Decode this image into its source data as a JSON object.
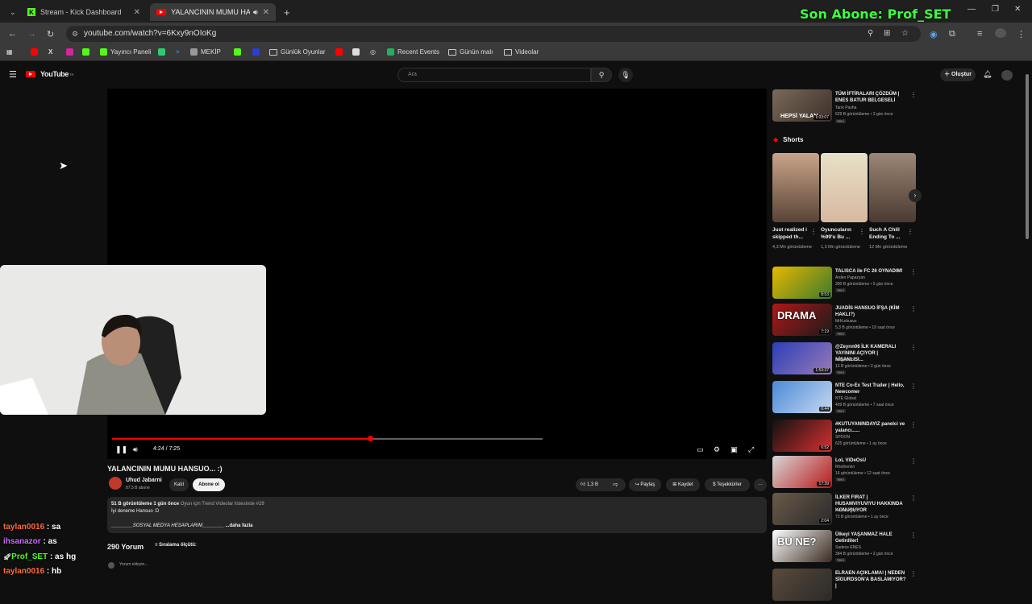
{
  "overlay": {
    "text": "Son Abone: Prof_SET"
  },
  "browser": {
    "tabs": [
      {
        "label": "Stream - Kick Dashboard"
      },
      {
        "label": "YALANCININ MUMU HANSU"
      }
    ],
    "url": "youtube.com/watch?v=6Kxy9nOIoKg",
    "bookmarks": [
      "Yayıncı Paneli",
      "MEKİP",
      "Günlük Oyunlar",
      "Recent Events",
      "Günün malı",
      "Videolar"
    ]
  },
  "youtube": {
    "logo": "YouTube",
    "logo_region": "TR",
    "search_placeholder": "Ara",
    "create_label": "Oluştur",
    "player": {
      "time": "4:24 / 7:25",
      "progress": 0.6
    },
    "video": {
      "title": "YALANCININ MUMU HANSUO... :)",
      "channel": "Uhud Jabarni",
      "subscribers": "87,5 B abone",
      "join_label": "Katıl",
      "subscribe_label": "Abone ol",
      "likes": "1,3 B",
      "share_label": "Paylaş",
      "save_label": "Kaydet",
      "thanks_label": "Teşekkürler"
    },
    "description": {
      "views": "51 B görüntüleme",
      "age": "1 gün önce",
      "trend": "Oyun için Trend Videolar listesinde #28",
      "line1": "İyi deneme Hansuo :D",
      "line2": "________SOSYAL MEDYA HESAPLARIM________",
      "more": "...daha fazla"
    },
    "comments": {
      "count": "290 Yorum",
      "sort": "Sıralama ölçütü:",
      "placeholder": "Yorum ekleyin..."
    },
    "shorts_label": "Shorts",
    "top_item": {
      "title": "TÜM İFTİRALARI ÇÖZDÜM | ENES BATUR BELGESELİ",
      "channel": "Tarık Pasha",
      "meta": "629 B görüntüleme • 3 gün önce",
      "badge": "Yeni",
      "duration": "1:03:07",
      "thumb_text": "HEPSİ YALAN"
    },
    "shorts": [
      {
        "title": "Just realized i skipped th...",
        "views": "4,3 Mn görüntüleme"
      },
      {
        "title": "Oyuncuların %99'u Bu ...",
        "views": "1,3 Mn görüntüleme"
      },
      {
        "title": "Such A Chill Ending To ...",
        "views": "12 Mn görüntüleme"
      }
    ],
    "recommendations": [
      {
        "title": "TALISCA ile FC 26 OYNADIM!",
        "channel": "Arden Papazyan",
        "meta": "300 B görüntüleme • 5 gün önce",
        "badge": "Yeni",
        "duration": "8:53"
      },
      {
        "title": "JUADİS HANSUO İFŞA (KİM HAKLI?)",
        "channel": "MrKurkusuz",
        "meta": "5,3 B görüntüleme • 19 saat önce",
        "badge": "Yeni",
        "duration": "7:19",
        "thumb_text": "DRAMA"
      },
      {
        "title": "@Zeyrın06 İLK KAMERALI YAYININI AÇIYOR | NİŞANLISI...",
        "channel": "MekipHub",
        "meta": "13 B görüntüleme • 2 gün önce",
        "badge": "Yeni",
        "duration": "1:53:37"
      },
      {
        "title": "NTE Co-Ex Test Trailer | Hello, Newcomer",
        "channel": "NTE Global",
        "meta": "409 B görüntüleme • 7 saat önce",
        "badge": "Yeni",
        "duration": "6:44"
      },
      {
        "title": "#KUTUYANINDAYIZ panelci ve yalancı......",
        "channel": "SPOON",
        "meta": "625 görüntüleme • 1 ay önce",
        "badge": "",
        "duration": "6:52"
      },
      {
        "title": "LoL ViDeOsU",
        "channel": "Rhothemin",
        "meta": "16 görüntüleme • 12 saat önce",
        "badge": "Yeni",
        "duration": "17:39"
      },
      {
        "title": "İLKER FIRAT | HUSAMVIYUVIYU HAKKINDA KONUŞUYOR",
        "channel": "Husam Clips",
        "meta": "73 B görüntüleme • 1 ay önce",
        "badge": "",
        "duration": "2:04"
      },
      {
        "title": "Ülkeyi YAŞANMAZ HALE Getirdiler!",
        "channel": "Sadece ENES",
        "meta": "384 B görüntüleme • 2 gün önce",
        "badge": "Yeni",
        "duration": "",
        "thumb_text": "BU NE?"
      },
      {
        "title": "ELRAEN AÇIKLAMA! | NEDEN SİGURDSON'A BASLAMIYOR? |",
        "channel": "",
        "meta": "",
        "badge": "",
        "duration": ""
      }
    ]
  },
  "chat": [
    {
      "user": "taylan0016",
      "msg": " : sa"
    },
    {
      "user": "ihsanazor",
      "msg": " : as"
    },
    {
      "user": "Prof_SET",
      "msg": " : as hg"
    },
    {
      "user": "taylan0016",
      "msg": " : hb"
    }
  ],
  "colors": {
    "accent": "#ff0000",
    "kick": "#53fc18",
    "overlay": "#3cff3c"
  }
}
